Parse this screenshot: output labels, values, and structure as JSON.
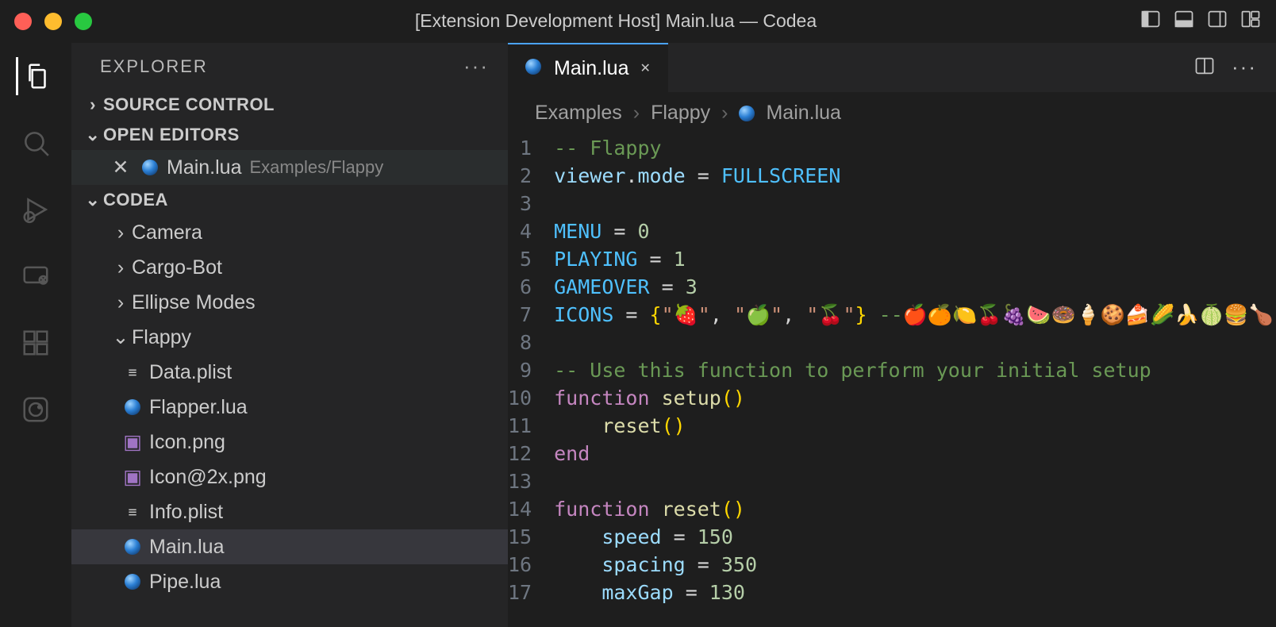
{
  "window": {
    "title": "[Extension Development Host] Main.lua — Codea"
  },
  "sidebar": {
    "title": "EXPLORER",
    "sections": {
      "source_control": "SOURCE CONTROL",
      "open_editors": "OPEN EDITORS",
      "workspace": "CODEA"
    },
    "open_editor": {
      "name": "Main.lua",
      "path": "Examples/Flappy"
    },
    "tree": {
      "folders": [
        "Camera",
        "Cargo-Bot",
        "Ellipse Modes",
        "Flappy"
      ],
      "flappy_files": [
        "Data.plist",
        "Flapper.lua",
        "Icon.png",
        "Icon@2x.png",
        "Info.plist",
        "Main.lua",
        "Pipe.lua"
      ]
    }
  },
  "tab": {
    "label": "Main.lua"
  },
  "breadcrumbs": [
    "Examples",
    "Flappy",
    "Main.lua"
  ],
  "code": {
    "lines": [
      1,
      2,
      3,
      4,
      5,
      6,
      7,
      8,
      9,
      10,
      11,
      12,
      13,
      14,
      15,
      16,
      17
    ],
    "l1_comment": "-- Flappy",
    "l2_a": "viewer",
    "l2_b": "mode",
    "l2_c": "FULLSCREEN",
    "l4_a": "MENU",
    "l4_b": "0",
    "l5_a": "PLAYING",
    "l5_b": "1",
    "l6_a": "GAMEOVER",
    "l6_b": "3",
    "l7_a": "ICONS",
    "l7_s1": "\"🍓\"",
    "l7_s2": "\"🍏\"",
    "l7_s3": "\"🍒\"",
    "l7_comment": "--🍎🍊🍋🍒🍇🍉🍩🍦🍪🍰🌽🍌🍈🍔🍗\"",
    "l9_comment": "-- Use this function to perform your initial setup",
    "l10_kw": "function",
    "l10_fn": "setup",
    "l11_fn": "reset",
    "l12_kw": "end",
    "l14_kw": "function",
    "l14_fn": "reset",
    "l15_a": "speed",
    "l15_b": "150",
    "l16_a": "spacing",
    "l16_b": "350",
    "l17_a": "maxGap",
    "l17_b": "130"
  }
}
